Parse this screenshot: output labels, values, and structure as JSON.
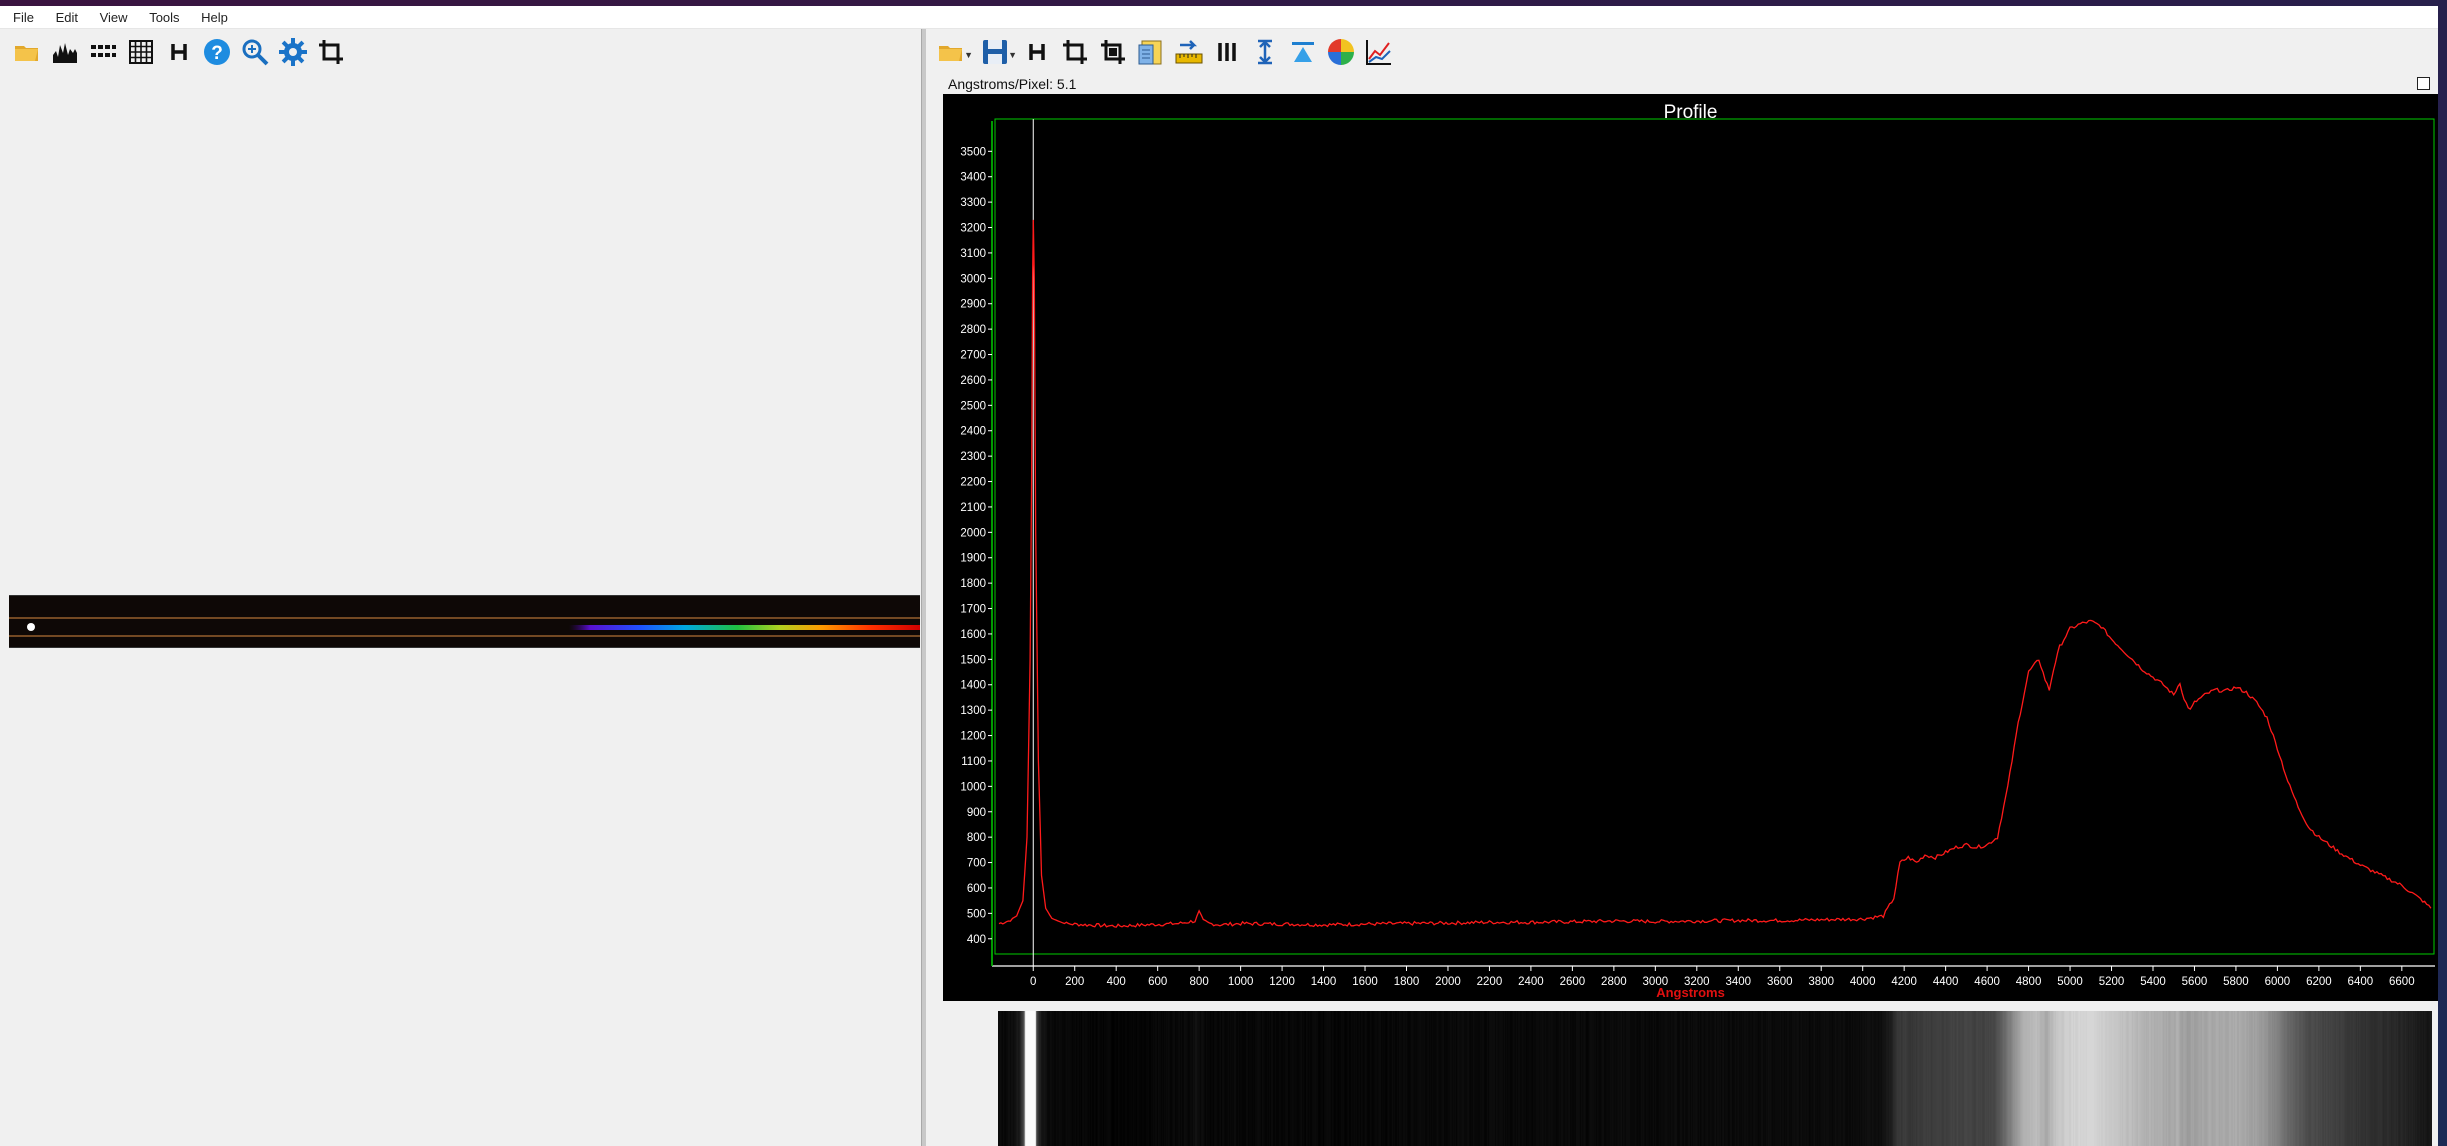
{
  "menu": {
    "items": [
      "File",
      "Edit",
      "View",
      "Tools",
      "Help"
    ]
  },
  "left_toolbar": {
    "icons": [
      "open-folder-icon",
      "histogram-icon",
      "rows-icon",
      "grid-icon",
      "h-icon",
      "help-icon",
      "zoom-in-icon",
      "settings-icon",
      "crop-icon"
    ]
  },
  "right_toolbar": {
    "icons": [
      "open-folder-icon",
      "save-icon",
      "h-icon",
      "crop-icon",
      "crop-alt-icon",
      "notes-icon",
      "calibrate-icon",
      "lines-icon",
      "vertical-stretch-icon",
      "beam-icon",
      "color-wheel-icon",
      "chart-icon"
    ]
  },
  "profile": {
    "px_label": "Angstroms/Pixel:  5.1",
    "chart_data": {
      "type": "line",
      "title": "Profile",
      "xlabel": "Angstroms",
      "ylabel": "",
      "xlim": [
        -170,
        6760
      ],
      "ylim": [
        340,
        3580
      ],
      "xticks": [
        0,
        200,
        400,
        600,
        800,
        1000,
        1200,
        1400,
        1600,
        1800,
        2000,
        2200,
        2400,
        2600,
        2800,
        3000,
        3200,
        3400,
        3600,
        3800,
        4000,
        4200,
        4400,
        4600,
        4800,
        5000,
        5200,
        5400,
        5600,
        5800,
        6000,
        6200,
        6400,
        6600
      ],
      "yticks": [
        400,
        500,
        600,
        700,
        800,
        900,
        1000,
        1100,
        1200,
        1300,
        1400,
        1500,
        1600,
        1700,
        1800,
        1900,
        2000,
        2100,
        2200,
        2300,
        2400,
        2500,
        2600,
        2700,
        2800,
        2900,
        3000,
        3100,
        3200,
        3300,
        3400,
        3500
      ],
      "grid": false,
      "marker_line_x": 0,
      "series": [
        {
          "color": "#ff1a1a",
          "x": [
            -165,
            -120,
            -80,
            -50,
            -30,
            -15,
            -8,
            -3,
            0,
            5,
            12,
            25,
            40,
            60,
            90,
            150,
            250,
            400,
            550,
            700,
            780,
            800,
            820,
            850,
            900,
            1000,
            1200,
            1400,
            1600,
            1800,
            2000,
            2200,
            2400,
            2600,
            2800,
            3000,
            3200,
            3400,
            3600,
            3800,
            4000,
            4100,
            4150,
            4180,
            4220,
            4260,
            4300,
            4350,
            4400,
            4450,
            4500,
            4550,
            4600,
            4650,
            4700,
            4750,
            4800,
            4850,
            4880,
            4900,
            4920,
            4950,
            5000,
            5050,
            5100,
            5150,
            5200,
            5250,
            5300,
            5350,
            5400,
            5450,
            5500,
            5530,
            5550,
            5580,
            5600,
            5650,
            5700,
            5750,
            5800,
            5850,
            5900,
            5950,
            6000,
            6050,
            6100,
            6150,
            6200,
            6300,
            6400,
            6500,
            6600,
            6700,
            6740
          ],
          "y": [
            460,
            470,
            490,
            550,
            800,
            1500,
            2200,
            3000,
            3230,
            3000,
            2000,
            1100,
            650,
            520,
            480,
            460,
            455,
            450,
            455,
            460,
            470,
            505,
            470,
            460,
            455,
            460,
            458,
            455,
            458,
            460,
            462,
            465,
            465,
            467,
            470,
            468,
            470,
            472,
            472,
            475,
            478,
            490,
            560,
            700,
            720,
            700,
            730,
            720,
            740,
            760,
            770,
            760,
            770,
            800,
            1000,
            1250,
            1450,
            1500,
            1420,
            1380,
            1460,
            1550,
            1620,
            1640,
            1650,
            1630,
            1580,
            1540,
            1500,
            1460,
            1430,
            1400,
            1360,
            1410,
            1340,
            1300,
            1330,
            1360,
            1380,
            1375,
            1390,
            1370,
            1330,
            1270,
            1150,
            1020,
            920,
            840,
            800,
            740,
            690,
            650,
            610,
            550,
            520
          ]
        }
      ]
    }
  },
  "colors": {
    "trace": "#ff1a1a",
    "axis": "#00cc00",
    "background": "#000000",
    "marker": "#ffffff"
  }
}
